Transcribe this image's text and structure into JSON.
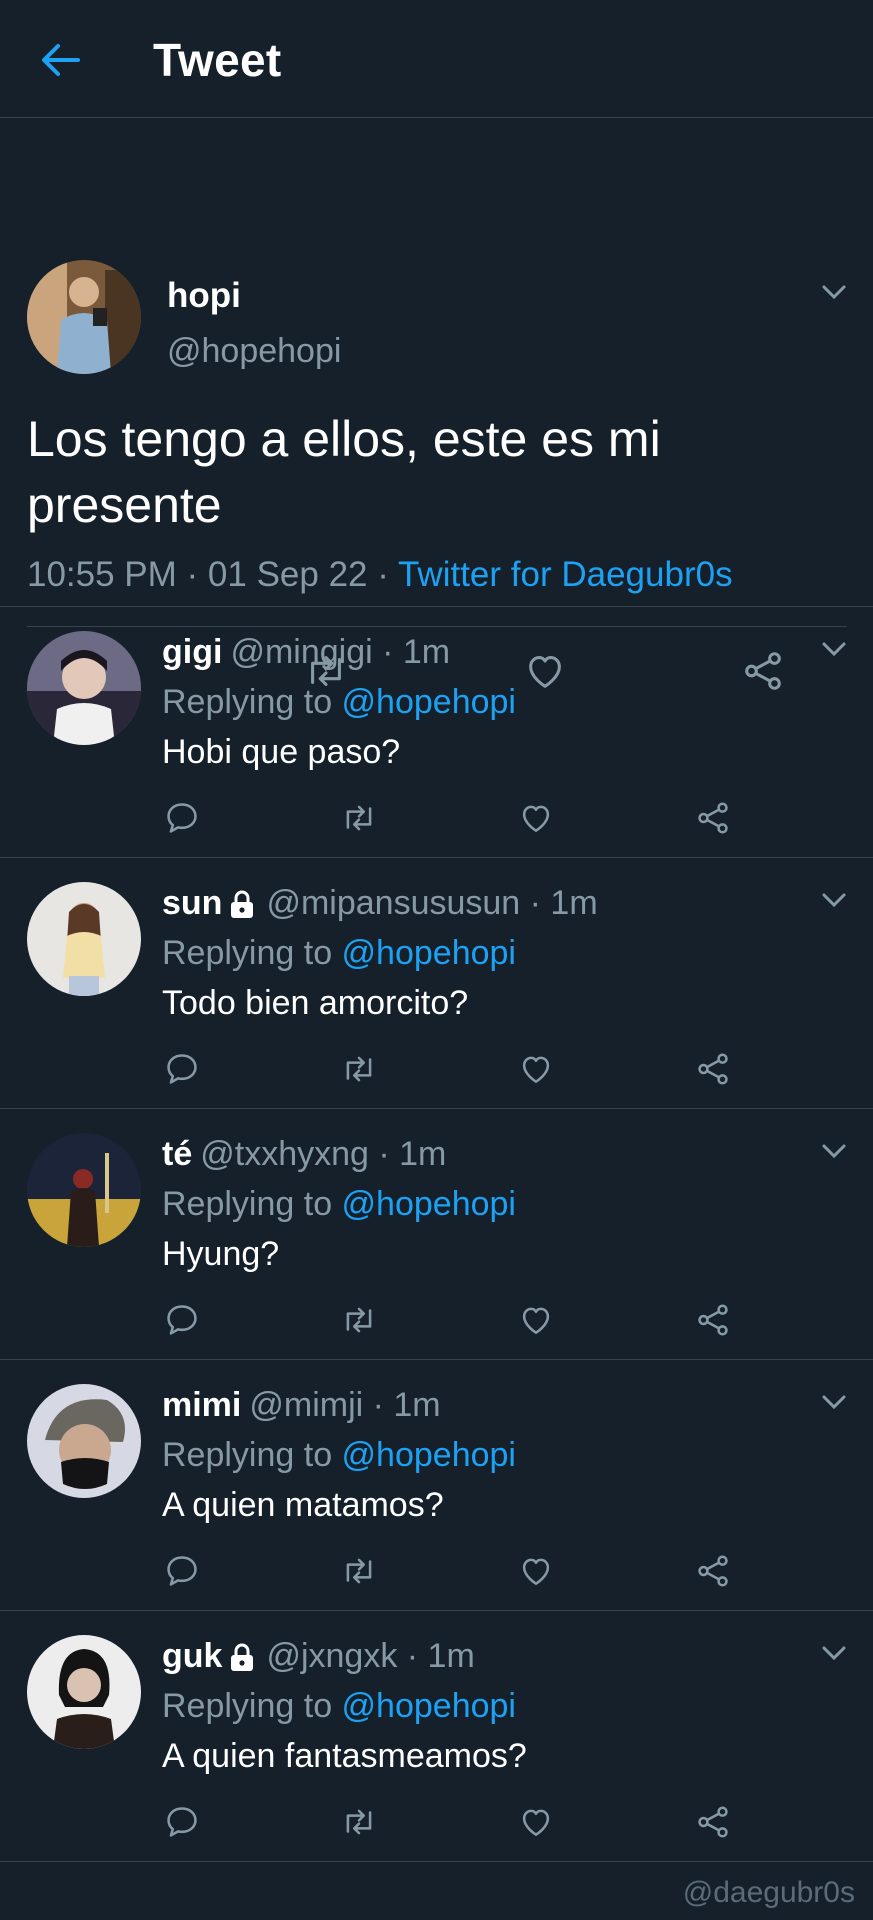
{
  "header": {
    "title": "Tweet"
  },
  "main_tweet": {
    "name": "hopi",
    "handle": "@hopehopi",
    "text": "Los tengo a ellos, este es mi presente",
    "time": "10:55 PM · 01 Sep 22 · ",
    "source": "Twitter for Daegubr0s"
  },
  "replies": [
    {
      "name": "gigi",
      "handle": "@mingigi · 1m",
      "replying_prefix": "Replying to ",
      "mention": "@hopehopi",
      "text": "Hobi que paso?",
      "locked": false
    },
    {
      "name": "sun",
      "handle": "@mipansususun · 1m",
      "replying_prefix": "Replying to ",
      "mention": "@hopehopi",
      "text": "Todo bien amorcito?",
      "locked": true
    },
    {
      "name": "té",
      "handle": "@txxhyxng · 1m",
      "replying_prefix": "Replying to ",
      "mention": "@hopehopi",
      "text": "Hyung?",
      "locked": false
    },
    {
      "name": "mimi",
      "handle": "@mimji · 1m",
      "replying_prefix": "Replying to ",
      "mention": "@hopehopi",
      "text": "A quien matamos?",
      "locked": false
    },
    {
      "name": "guk",
      "handle": "@jxngxk · 1m",
      "replying_prefix": "Replying to ",
      "mention": "@hopehopi",
      "text": "A quien fantasmeamos?",
      "locked": true
    }
  ],
  "watermark": "@daegubr0s",
  "colors": {
    "background": "#15202b",
    "accent": "#1da1f2",
    "secondary_text": "#8899a6",
    "divider": "#38444d"
  },
  "icons": [
    "back-arrow-icon",
    "chevron-down-icon",
    "reply-icon",
    "retweet-icon",
    "like-icon",
    "share-icon",
    "lock-icon"
  ]
}
